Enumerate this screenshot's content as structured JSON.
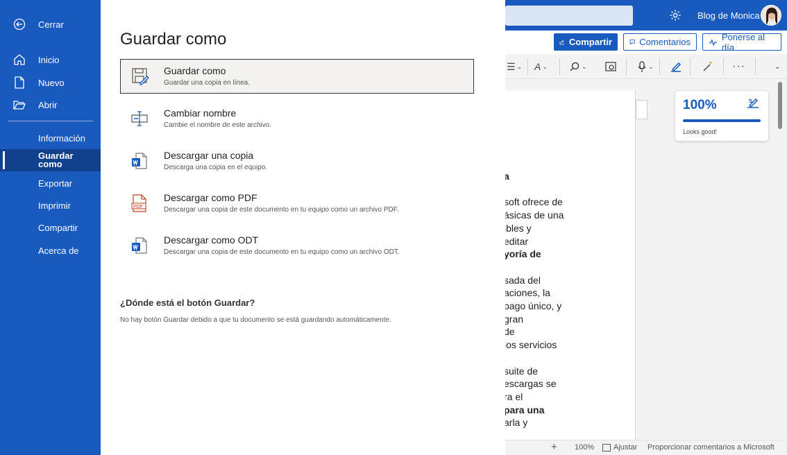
{
  "header": {
    "user_name": "Blog de Monica",
    "share_label": "Compartir",
    "comments_label": "Comentarios",
    "catchup_label": "Ponerse al día"
  },
  "backstage": {
    "nav": {
      "close": "Cerrar",
      "home": "Inicio",
      "new": "Nuevo",
      "open": "Abrir",
      "info": "Información",
      "save_as": "Guardar como",
      "export": "Exportar",
      "print": "Imprimir",
      "share": "Compartir",
      "about": "Acerca de"
    },
    "title": "Guardar como",
    "options": [
      {
        "title": "Guardar como",
        "desc": "Guardar una copia en línea."
      },
      {
        "title": "Cambiar nombre",
        "desc": "Cambie el nombre de este archivo."
      },
      {
        "title": "Descargar una copia",
        "desc": "Descarga una copia en el equipo."
      },
      {
        "title": "Descargar como PDF",
        "desc": "Descargar una copia de este documento en tu equipo como un archivo PDF."
      },
      {
        "title": "Descargar como ODT",
        "desc": "Descargar una copia de este documento en tu equipo como un archivo ODT."
      }
    ],
    "where_heading": "¿Dónde está el botón Guardar?",
    "where_text": "No hay botón Guardar debido a que tu documento se está guardando automáticamente."
  },
  "document": {
    "lines": [
      {
        "text": "a",
        "bold": true
      },
      {
        "text": "",
        "bold": false
      },
      {
        "text": "soft ofrece de",
        "bold": false
      },
      {
        "text": "ásicas de una",
        "bold": false
      },
      {
        "text": "ibles y",
        "bold": false
      },
      {
        "text": "editar",
        "bold": false
      },
      {
        "text": "yoría de",
        "bold": true
      },
      {
        "text": "",
        "bold": false
      },
      {
        "text": "sada del",
        "bold": false
      },
      {
        "text": "aciones, la",
        "bold": false
      },
      {
        "text": "pago único, y",
        "bold": false
      },
      {
        "text": " gran",
        "bold": false
      },
      {
        "text": "de",
        "bold": false
      },
      {
        "text": "los servicios",
        "bold": false
      },
      {
        "text": "",
        "bold": false
      },
      {
        "text": " suite de",
        "bold": false
      },
      {
        "text": "escargas se",
        "bold": false
      },
      {
        "text": "ra el",
        "bold": false
      },
      {
        "text": "para una",
        "bold": true
      },
      {
        "text": "arla y",
        "bold": false
      }
    ]
  },
  "editor": {
    "score": "100%",
    "status": "Looks good!",
    "fill_fraction": 1.0
  },
  "statusbar": {
    "zoom": "100%",
    "fit": "Ajustar",
    "feedback": "Proporcionar comentarios a Microsoft"
  },
  "colors": {
    "brand": "#185abd",
    "selected_nav": "#11408d"
  }
}
